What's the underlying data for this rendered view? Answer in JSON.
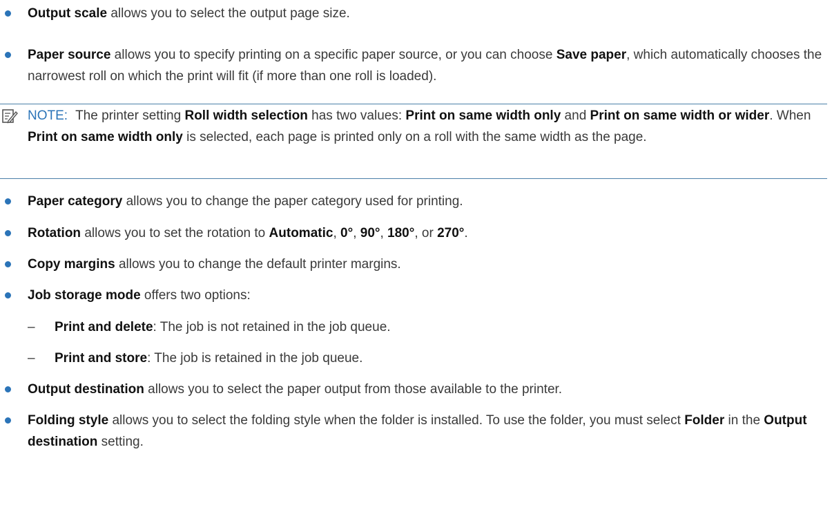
{
  "bullets": [
    {
      "term": "Output scale",
      "text": " allows you to select the output page size."
    },
    {
      "term": "Paper source",
      "text_a": " allows you to specify printing on a specific paper source, or you can choose ",
      "term2": "Save paper",
      "text_b": ", which automatically chooses the narrowest roll on which the print will fit (if more than one roll is loaded)."
    }
  ],
  "note": {
    "label": "NOTE:",
    "t1": "The printer setting ",
    "b1": "Roll width selection",
    "t2": " has two values: ",
    "b2": "Print on same width only",
    "t3": " and ",
    "b3": "Print on same width or wider",
    "t4": ". When ",
    "b4": "Print on same width only",
    "t5": " is selected, each page is printed only on a roll with the same width as the page."
  },
  "items": {
    "paper_category": {
      "term": "Paper category",
      "text": " allows you to change the paper category used for printing."
    },
    "rotation": {
      "term": "Rotation",
      "t1": " allows you to set the rotation to ",
      "v1": "Automatic",
      "s1": ", ",
      "v2": "0°",
      "s2": ", ",
      "v3": "90°",
      "s3": ", ",
      "v4": "180°",
      "s4": ", or ",
      "v5": "270°",
      "end": "."
    },
    "copy_margins": {
      "term": "Copy margins",
      "text": " allows you to change the default printer margins."
    },
    "job_storage": {
      "term": "Job storage mode",
      "text": " offers two options:"
    },
    "sub1": {
      "dash": "–",
      "term": "Print and delete",
      "text": ": The job is not retained in the job queue."
    },
    "sub2": {
      "dash": "–",
      "term": "Print and store",
      "text": ": The job is retained in the job queue."
    },
    "output_destination": {
      "term": "Output destination",
      "text": " allows you to select the paper output from those available to the printer."
    },
    "folding_style": {
      "term": "Folding style",
      "t1": " allows you to select the folding style when the folder is installed. To use the folder, you must select ",
      "b1": "Folder",
      "t2": " in the ",
      "b2": "Output destination",
      "t3": " setting."
    }
  },
  "colors": {
    "accent": "#2b74b8",
    "text": "#3a3a3a",
    "rule": "#4a7fa8"
  },
  "icons": {
    "note": "note-pencil-icon"
  }
}
